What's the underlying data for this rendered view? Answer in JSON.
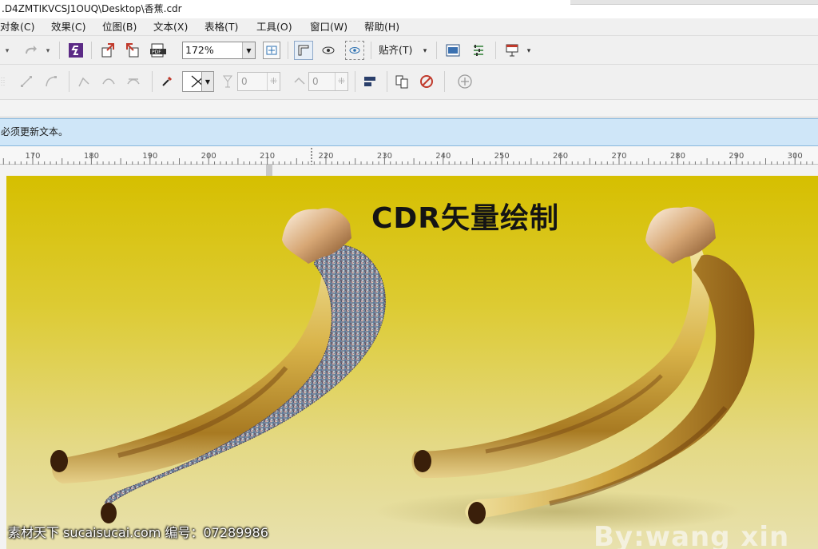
{
  "window": {
    "title": ".D4ZMTIKVCSJ1OUQ\\Desktop\\香蕉.cdr"
  },
  "menu": [
    {
      "label": "对象(C)"
    },
    {
      "label": "效果(C)"
    },
    {
      "label": "位图(B)"
    },
    {
      "label": "文本(X)"
    },
    {
      "label": "表格(T)"
    },
    {
      "label": "工具(O)"
    },
    {
      "label": "窗口(W)"
    },
    {
      "label": "帮助(H)"
    }
  ],
  "toolbar": {
    "zoom_value": "172%",
    "snap_label": "贴齐(T)",
    "spin1_value": "0",
    "spin2_value": "0"
  },
  "infobar": {
    "message": "必须更新文本。"
  },
  "ruler": {
    "ticks": [
      170,
      180,
      190,
      200,
      210,
      220,
      230,
      240,
      250,
      260,
      270,
      280,
      290,
      300
    ]
  },
  "document": {
    "title": "CDR矢量绘制",
    "byline": "By:wang xin"
  },
  "watermark": "素材天下 sucaisucai.com  编号：07289986",
  "colors": {
    "infobar_bg": "#cfe6f8",
    "page_top": "#d6bf00",
    "page_bottom": "#e8e1ae",
    "banana_body": "#e6c95c",
    "banana_shade": "#8a5a14"
  }
}
